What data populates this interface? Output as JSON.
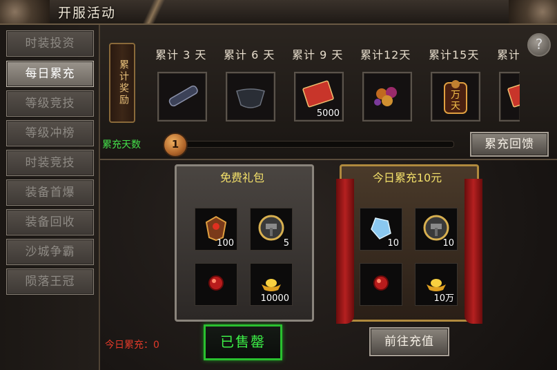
{
  "window": {
    "title": "开服活动"
  },
  "sidebar": {
    "items": [
      {
        "label": "时装投资",
        "active": false
      },
      {
        "label": "每日累充",
        "active": true
      },
      {
        "label": "等级竞技",
        "active": false
      },
      {
        "label": "等级冲榜",
        "active": false
      },
      {
        "label": "时装竞技",
        "active": false
      },
      {
        "label": "装备首爆",
        "active": false
      },
      {
        "label": "装备回收",
        "active": false
      },
      {
        "label": "沙城争霸",
        "active": false
      },
      {
        "label": "陨落王冠",
        "active": false
      }
    ]
  },
  "rewards": {
    "banner": "累计奖励",
    "days": [
      {
        "label": "累计 3 天",
        "icon": "scroll-icon",
        "count": ""
      },
      {
        "label": "累计 6 天",
        "icon": "mask-icon",
        "count": ""
      },
      {
        "label": "累计 9 天",
        "icon": "red-envelope-icon",
        "count": "5000"
      },
      {
        "label": "累计12天",
        "icon": "gem-pile-icon",
        "count": ""
      },
      {
        "label": "累计15天",
        "icon": "wanfu-badge-icon",
        "count": ""
      },
      {
        "label": "累计",
        "icon": "red-envelope-icon",
        "count": ""
      }
    ],
    "wanfu_text": "万 天"
  },
  "help": {
    "label": "?"
  },
  "progress": {
    "label": "累充天数",
    "value": "1",
    "fill_fraction": 0.02
  },
  "feedback_button": {
    "label": "累充回馈"
  },
  "packs": {
    "free": {
      "title": "免费礼包",
      "items": [
        {
          "icon": "crest-icon",
          "count": "100"
        },
        {
          "icon": "hammer-medal-icon",
          "count": "5"
        },
        {
          "icon": "red-orb-icon",
          "count": ""
        },
        {
          "icon": "gold-ingot-icon",
          "count": "10000"
        }
      ]
    },
    "paid": {
      "title": "今日累充10元",
      "items": [
        {
          "icon": "blue-crystal-icon",
          "count": "10"
        },
        {
          "icon": "hammer-medal-icon",
          "count": "10"
        },
        {
          "icon": "red-orb-icon",
          "count": ""
        },
        {
          "icon": "gold-ingot-icon",
          "count": "10万"
        }
      ]
    }
  },
  "sold_button": {
    "label": "已售罄"
  },
  "recharge_button": {
    "label": "前往充值"
  },
  "today": {
    "label": "今日累充：0"
  },
  "colors": {
    "accent_green": "#3cf047",
    "accent_red": "#e23a2a",
    "gold_text": "#f3e06a"
  }
}
